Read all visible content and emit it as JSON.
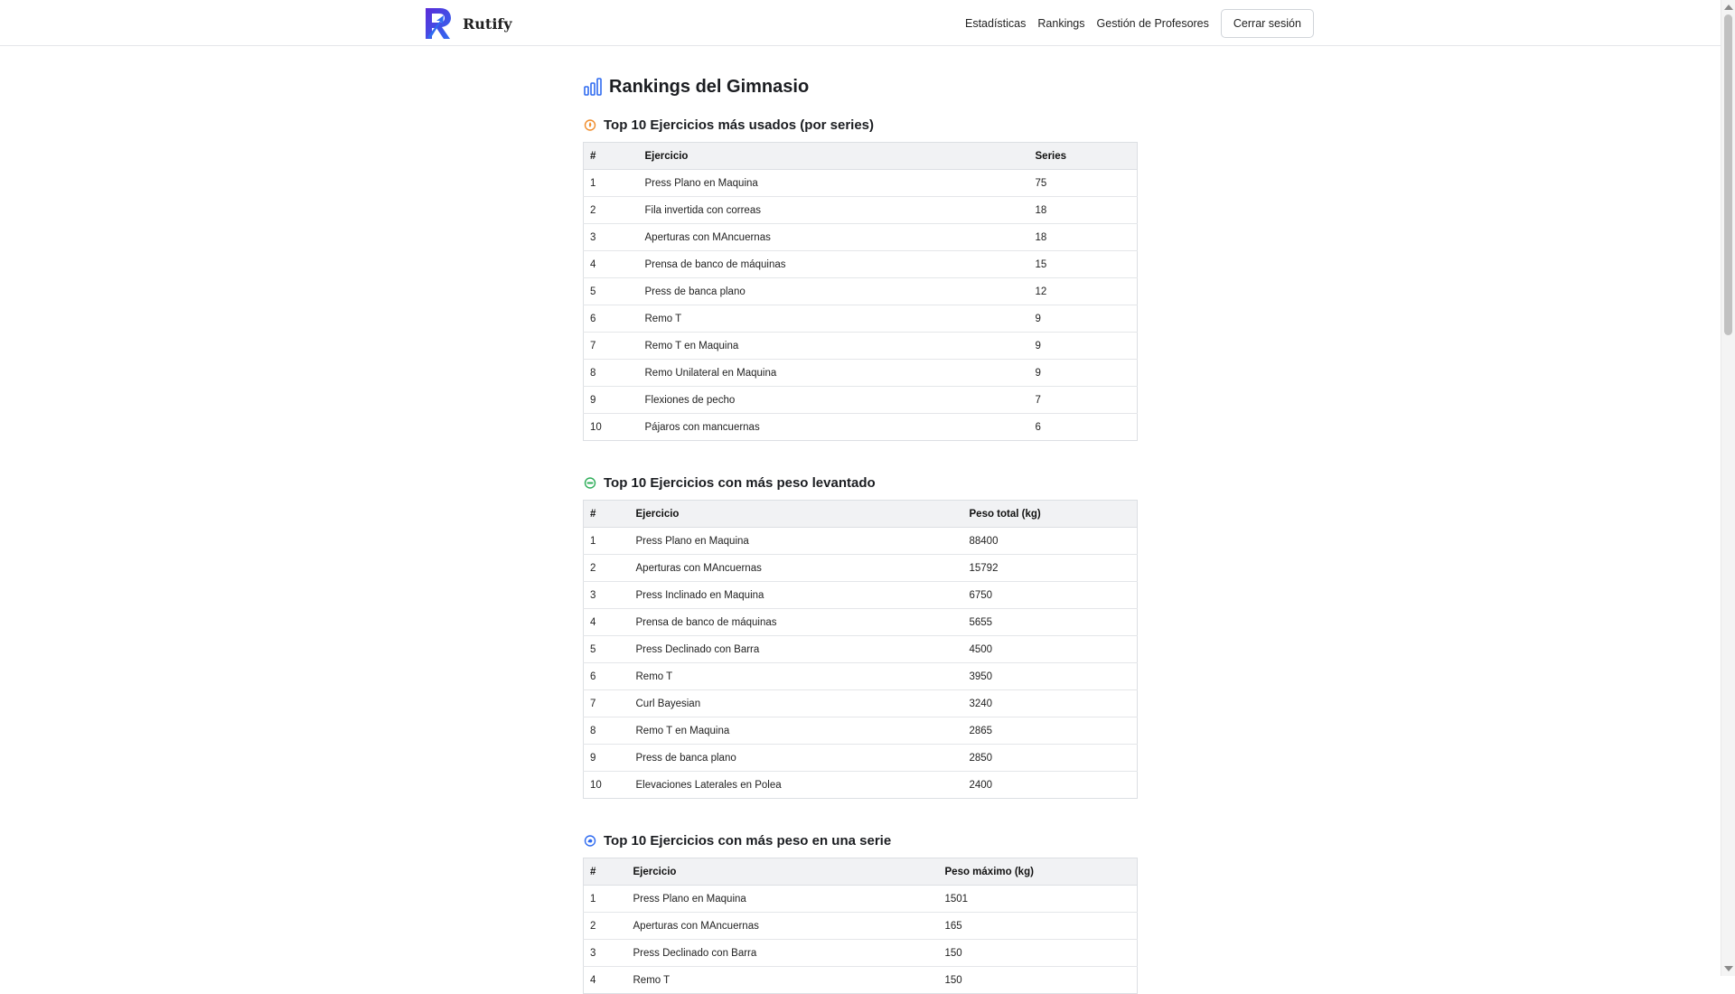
{
  "brand": {
    "name": "Rutify",
    "logo_icon": "rutify-r-logo-icon",
    "logo_colors": [
      "#5b2bd8",
      "#2f6bf0"
    ]
  },
  "nav": {
    "links": [
      "Estadísticas",
      "Rankings",
      "Gestión de Profesores"
    ],
    "logout_label": "Cerrar sesión"
  },
  "page": {
    "title": "Rankings del Gimnasio",
    "title_icon": "bar-chart-icon",
    "accent": "#2f6bf0"
  },
  "sections": [
    {
      "title": "Top 10 Ejercicios más usados (por series)",
      "icon": "fire-icon",
      "icon_color": "#f08c2a",
      "columns": [
        "#",
        "Ejercicio",
        "Series"
      ],
      "rows": [
        [
          "1",
          "Press Plano en Maquina",
          "75"
        ],
        [
          "2",
          "Fila invertida con correas",
          "18"
        ],
        [
          "3",
          "Aperturas con MAncuernas",
          "18"
        ],
        [
          "4",
          "Prensa de banco de máquinas",
          "15"
        ],
        [
          "5",
          "Press de banca plano",
          "12"
        ],
        [
          "6",
          "Remo T",
          "9"
        ],
        [
          "7",
          "Remo T en Maquina",
          "9"
        ],
        [
          "8",
          "Remo Unilateral en Maquina",
          "9"
        ],
        [
          "9",
          "Flexiones de pecho",
          "7"
        ],
        [
          "10",
          "Pájaros con mancuernas",
          "6"
        ]
      ]
    },
    {
      "title": "Top 10 Ejercicios con más peso levantado",
      "icon": "weight-icon",
      "icon_color": "#2fae5a",
      "columns": [
        "#",
        "Ejercicio",
        "Peso total (kg)"
      ],
      "rows": [
        [
          "1",
          "Press Plano en Maquina",
          "88400"
        ],
        [
          "2",
          "Aperturas con MAncuernas",
          "15792"
        ],
        [
          "3",
          "Press Inclinado en Maquina",
          "6750"
        ],
        [
          "4",
          "Prensa de banco de máquinas",
          "5655"
        ],
        [
          "5",
          "Press Declinado con Barra",
          "4500"
        ],
        [
          "6",
          "Remo T",
          "3950"
        ],
        [
          "7",
          "Curl Bayesian",
          "3240"
        ],
        [
          "8",
          "Remo T en Maquina",
          "2865"
        ],
        [
          "9",
          "Press de banca plano",
          "2850"
        ],
        [
          "10",
          "Elevaciones Laterales en Polea",
          "2400"
        ]
      ]
    },
    {
      "title": "Top 10 Ejercicios con más peso en una serie",
      "icon": "muscle-icon",
      "icon_color": "#2f6bf0",
      "columns": [
        "#",
        "Ejercicio",
        "Peso máximo (kg)"
      ],
      "rows": [
        [
          "1",
          "Press Plano en Maquina",
          "1501"
        ],
        [
          "2",
          "Aperturas con MAncuernas",
          "165"
        ],
        [
          "3",
          "Press Declinado con Barra",
          "150"
        ],
        [
          "4",
          "Remo T",
          "150"
        ]
      ]
    }
  ]
}
